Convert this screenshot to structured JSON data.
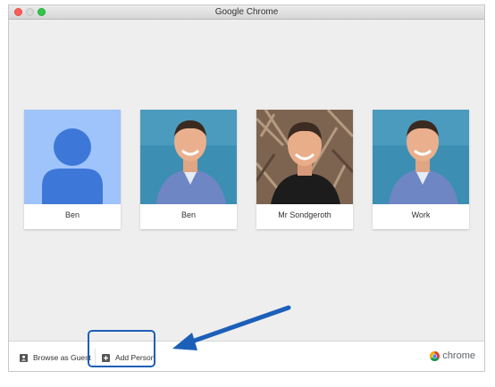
{
  "window": {
    "title": "Google Chrome"
  },
  "profiles": [
    {
      "name": "Ben",
      "avatar": "default-person-icon"
    },
    {
      "name": "Ben",
      "avatar": "photo"
    },
    {
      "name": "Mr Sondgeroth",
      "avatar": "photo"
    },
    {
      "name": "Work",
      "avatar": "photo"
    }
  ],
  "bottom_bar": {
    "guest_label": "Browse as Guest",
    "add_person_label": "Add Person",
    "brand_label": "chrome"
  },
  "colors": {
    "accent": "#1b5fb8",
    "default_avatar_bg": "#9fc3fb",
    "default_avatar_fg": "#3d78d8"
  }
}
